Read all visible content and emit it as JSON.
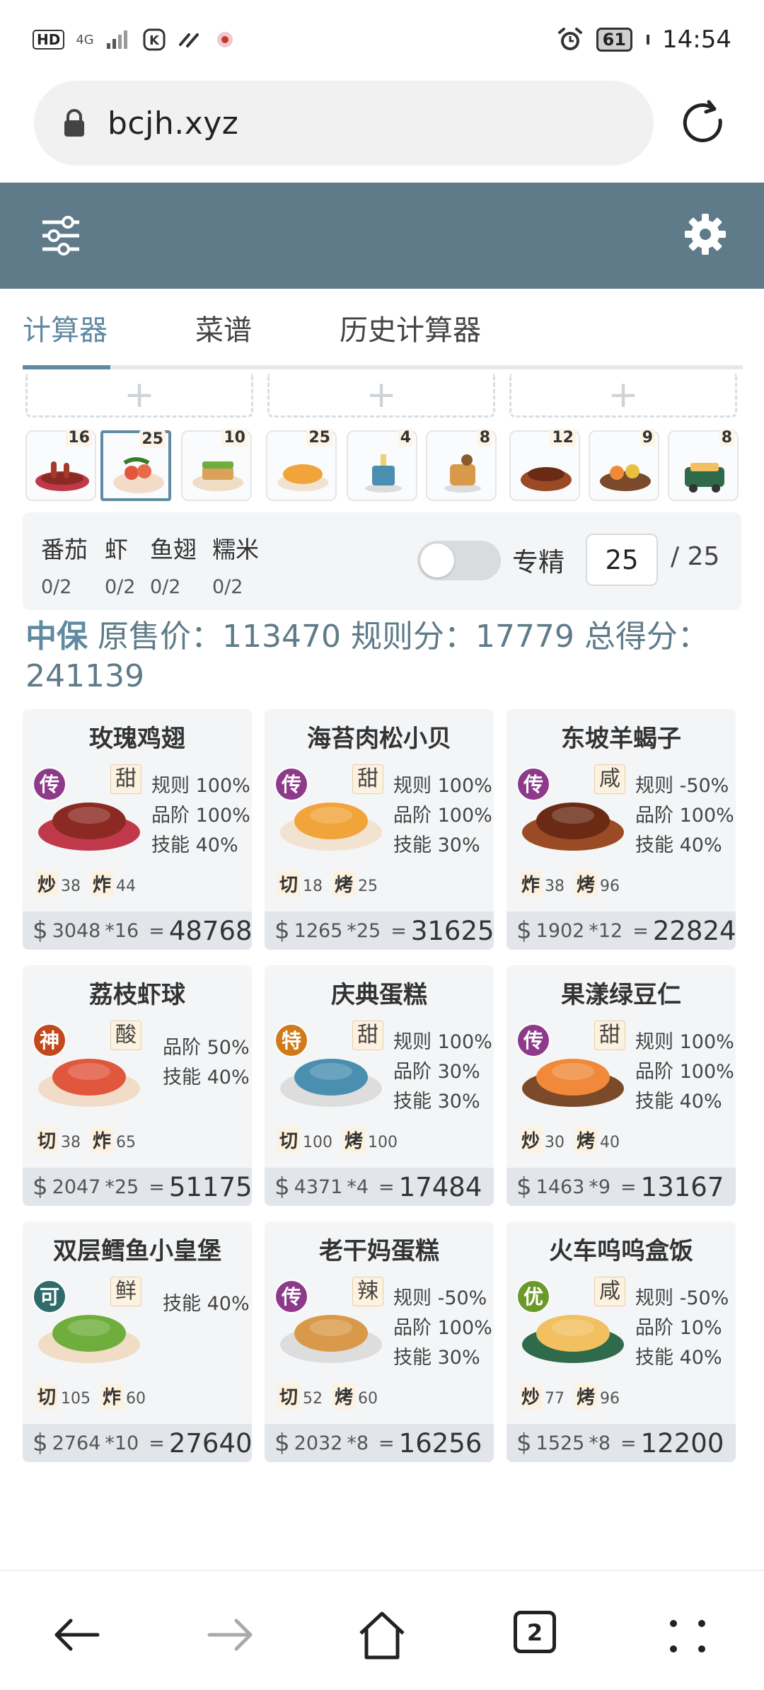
{
  "status_bar": {
    "left_badge": "HD",
    "network": "4G",
    "battery": "61",
    "time": "14:54"
  },
  "browser": {
    "url": "bcjh.xyz"
  },
  "tabs": [
    {
      "label": "计算器",
      "active": true
    },
    {
      "label": "菜谱",
      "active": false
    },
    {
      "label": "历史计算器",
      "active": false
    }
  ],
  "chef_slots": [
    "+",
    "+",
    "+"
  ],
  "recipe_thumbs": [
    {
      "count": "16",
      "selected": false
    },
    {
      "count": "25",
      "selected": true
    },
    {
      "count": "10",
      "selected": false
    },
    {
      "count": "25",
      "selected": false
    },
    {
      "count": "4",
      "selected": false
    },
    {
      "count": "8",
      "selected": false
    },
    {
      "count": "12",
      "selected": false
    },
    {
      "count": "9",
      "selected": false
    },
    {
      "count": "8",
      "selected": false
    }
  ],
  "materials": [
    {
      "name": "番茄",
      "count": "0/2"
    },
    {
      "name": "虾",
      "count": "0/2"
    },
    {
      "name": "鱼翅",
      "count": "0/2"
    },
    {
      "name": "糯米",
      "count": "0/2"
    }
  ],
  "mastery": {
    "label": "专精",
    "on": false,
    "level": "25",
    "max": "/ 25"
  },
  "summary": {
    "strategy": "中保",
    "text": "原售价：113470 规则分：17779 总得分：241139"
  },
  "cards": [
    {
      "title": "玫瑰鸡翅",
      "rarity": "传",
      "rarity_color": "#8e3a8a",
      "condiment": "甜",
      "stats": [
        "规则 100%",
        "品阶 100%",
        "技能 40%"
      ],
      "skills": [
        {
          "n": "炒",
          "v": "38"
        },
        {
          "n": "炸",
          "v": "44"
        }
      ],
      "price": "3048",
      "mult": "*16",
      "total": "48768"
    },
    {
      "title": "海苔肉松小贝",
      "rarity": "传",
      "rarity_color": "#8e3a8a",
      "condiment": "甜",
      "stats": [
        "规则 100%",
        "品阶 100%",
        "技能 30%"
      ],
      "skills": [
        {
          "n": "切",
          "v": "18"
        },
        {
          "n": "烤",
          "v": "25"
        }
      ],
      "price": "1265",
      "mult": "*25",
      "total": "31625"
    },
    {
      "title": "东坡羊蝎子",
      "rarity": "传",
      "rarity_color": "#8e3a8a",
      "condiment": "咸",
      "stats": [
        "规则 -50%",
        "品阶 100%",
        "技能 40%"
      ],
      "skills": [
        {
          "n": "炸",
          "v": "38"
        },
        {
          "n": "烤",
          "v": "96"
        }
      ],
      "price": "1902",
      "mult": "*12",
      "total": "22824"
    },
    {
      "title": "荔枝虾球",
      "rarity": "神",
      "rarity_color": "#c2491d",
      "condiment": "酸",
      "stats": [
        "品阶 50%",
        "技能 40%"
      ],
      "skills": [
        {
          "n": "切",
          "v": "38"
        },
        {
          "n": "炸",
          "v": "65"
        }
      ],
      "price": "2047",
      "mult": "*25",
      "total": "51175"
    },
    {
      "title": "庆典蛋糕",
      "rarity": "特",
      "rarity_color": "#d07a1a",
      "condiment": "甜",
      "stats": [
        "规则 100%",
        "品阶 30%",
        "技能 30%"
      ],
      "skills": [
        {
          "n": "切",
          "v": "100"
        },
        {
          "n": "烤",
          "v": "100"
        }
      ],
      "price": "4371",
      "mult": "*4",
      "total": "17484"
    },
    {
      "title": "果漾绿豆仁",
      "rarity": "传",
      "rarity_color": "#8e3a8a",
      "condiment": "甜",
      "stats": [
        "规则 100%",
        "品阶 100%",
        "技能 40%"
      ],
      "skills": [
        {
          "n": "炒",
          "v": "30"
        },
        {
          "n": "烤",
          "v": "40"
        }
      ],
      "price": "1463",
      "mult": "*9",
      "total": "13167"
    },
    {
      "title": "双层鳕鱼小皇堡",
      "rarity": "可",
      "rarity_color": "#2f6b6b",
      "condiment": "鲜",
      "stats": [
        "技能 40%"
      ],
      "skills": [
        {
          "n": "切",
          "v": "105"
        },
        {
          "n": "炸",
          "v": "60"
        }
      ],
      "price": "2764",
      "mult": "*10",
      "total": "27640"
    },
    {
      "title": "老干妈蛋糕",
      "rarity": "传",
      "rarity_color": "#8e3a8a",
      "condiment": "辣",
      "stats": [
        "规则 -50%",
        "品阶 100%",
        "技能 30%"
      ],
      "skills": [
        {
          "n": "切",
          "v": "52"
        },
        {
          "n": "烤",
          "v": "60"
        }
      ],
      "price": "2032",
      "mult": "*8",
      "total": "16256"
    },
    {
      "title": "火车呜呜盒饭",
      "rarity": "优",
      "rarity_color": "#6a9a2a",
      "condiment": "咸",
      "stats": [
        "规则 -50%",
        "品阶 10%",
        "技能 40%"
      ],
      "skills": [
        {
          "n": "炒",
          "v": "77"
        },
        {
          "n": "烤",
          "v": "96"
        }
      ],
      "price": "1525",
      "mult": "*8",
      "total": "12200"
    }
  ],
  "bottom_nav": {
    "tab_count": "2"
  },
  "colors": {
    "header": "#5f7b89",
    "accent": "#5f8aa1",
    "card_bg": "#f3f5f7"
  }
}
